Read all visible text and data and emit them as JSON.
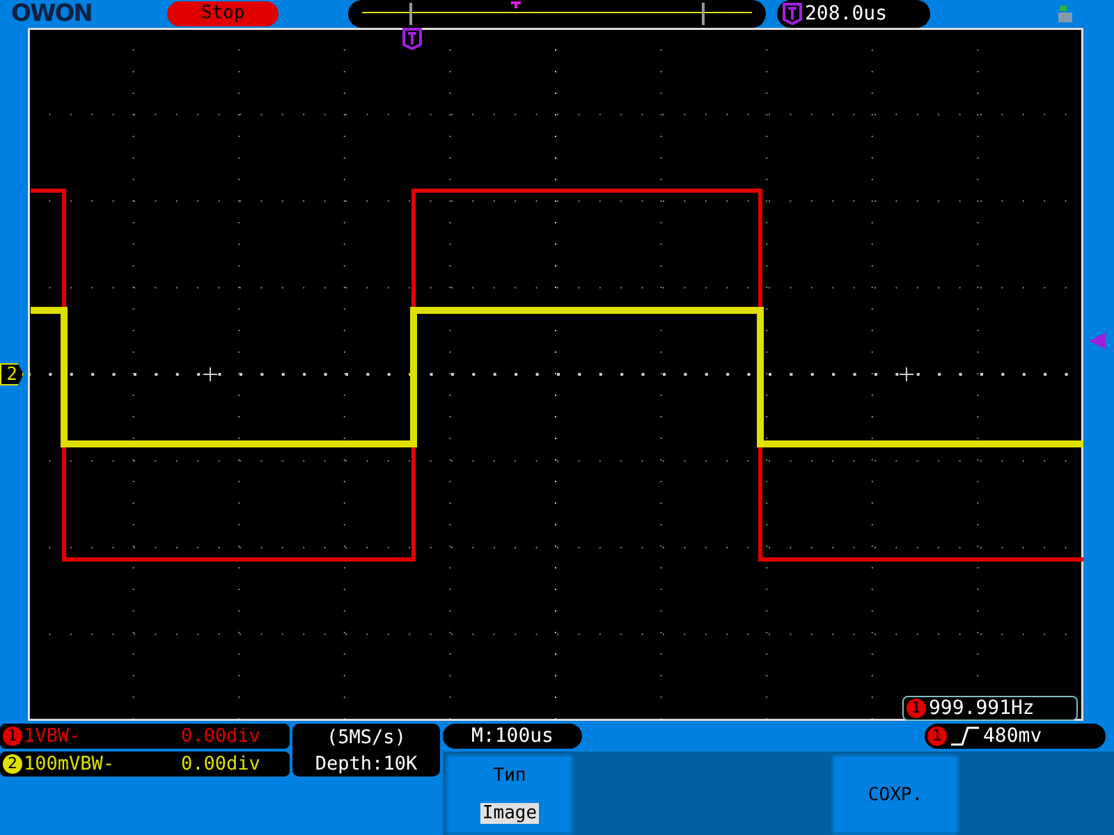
{
  "top_bar": {
    "logo": "OWON",
    "run_state": "Stop",
    "trigger_time": "208.0us"
  },
  "screen": {
    "frequency": {
      "channel": "1",
      "value": "999.991Hz"
    },
    "channel_marker": "2"
  },
  "channels": [
    {
      "number": "1",
      "scale": "1VBW-",
      "offset": "0.00div",
      "color": "#e00000"
    },
    {
      "number": "2",
      "scale": "100mVBW-",
      "offset": "0.00div",
      "color": "#e0e000"
    }
  ],
  "acquisition": {
    "sample_rate": "(5MS/s)",
    "depth": "Depth:10K"
  },
  "timebase": "M:100us",
  "trigger": {
    "channel": "1",
    "level": "480mv"
  },
  "menu": [
    {
      "kind": "labeled",
      "label": "Тип",
      "value": "Image"
    },
    {
      "kind": "plain",
      "label": "СОХР."
    }
  ]
}
